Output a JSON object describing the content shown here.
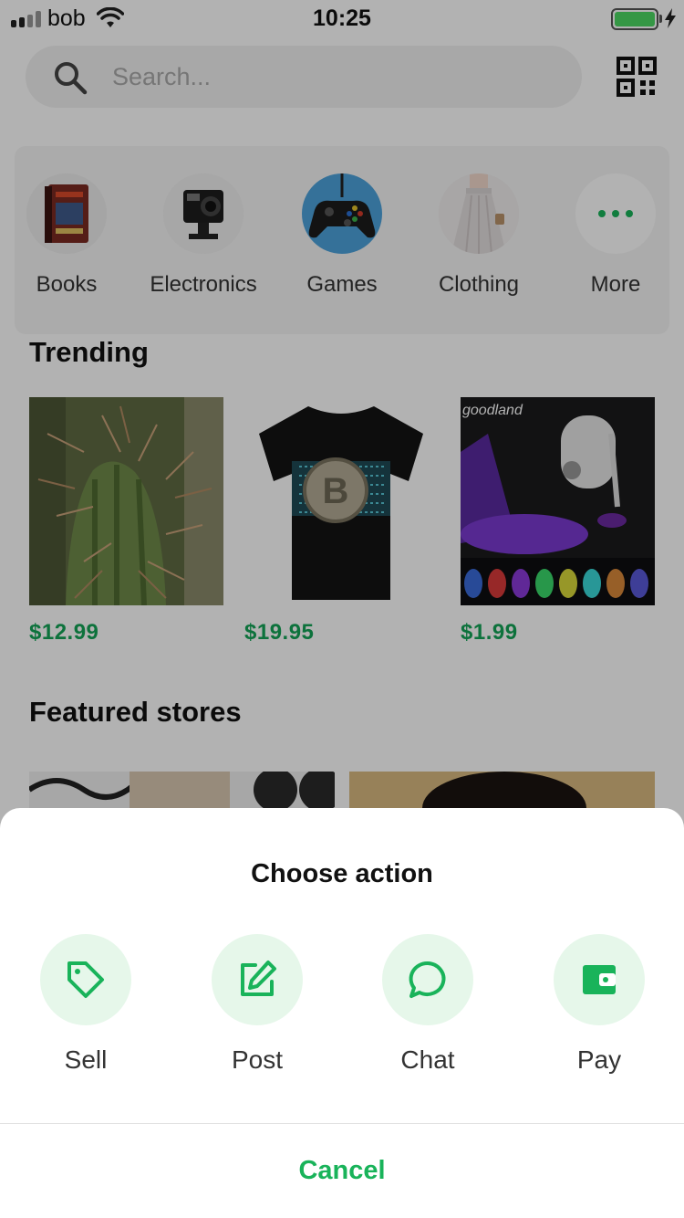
{
  "status_bar": {
    "carrier": "bob",
    "time": "10:25"
  },
  "search": {
    "placeholder": "Search..."
  },
  "categories": [
    {
      "label": "Books",
      "icon": "book-image"
    },
    {
      "label": "Electronics",
      "icon": "camera-image"
    },
    {
      "label": "Games",
      "icon": "gamepad-image"
    },
    {
      "label": "Clothing",
      "icon": "skirt-image"
    },
    {
      "label": "More",
      "icon": "more-dots-icon"
    }
  ],
  "trending": {
    "title": "Trending",
    "items": [
      {
        "price": "$12.99",
        "image": "cactus-image"
      },
      {
        "price": "$19.95",
        "image": "bitcoin-tshirt-image"
      },
      {
        "price": "$1.99",
        "image": "toilet-light-image",
        "brand_text": "goodland"
      }
    ]
  },
  "featured": {
    "title": "Featured stores"
  },
  "action_sheet": {
    "title": "Choose action",
    "actions": [
      {
        "label": "Sell",
        "icon": "tag-icon"
      },
      {
        "label": "Post",
        "icon": "edit-icon"
      },
      {
        "label": "Chat",
        "icon": "chat-bubble-icon"
      },
      {
        "label": "Pay",
        "icon": "wallet-icon"
      }
    ],
    "cancel": "Cancel"
  },
  "colors": {
    "accent": "#19b35a",
    "price": "#13a456",
    "action_bg": "#e6f7ea",
    "overlay": "rgba(0,0,0,0.30)"
  }
}
